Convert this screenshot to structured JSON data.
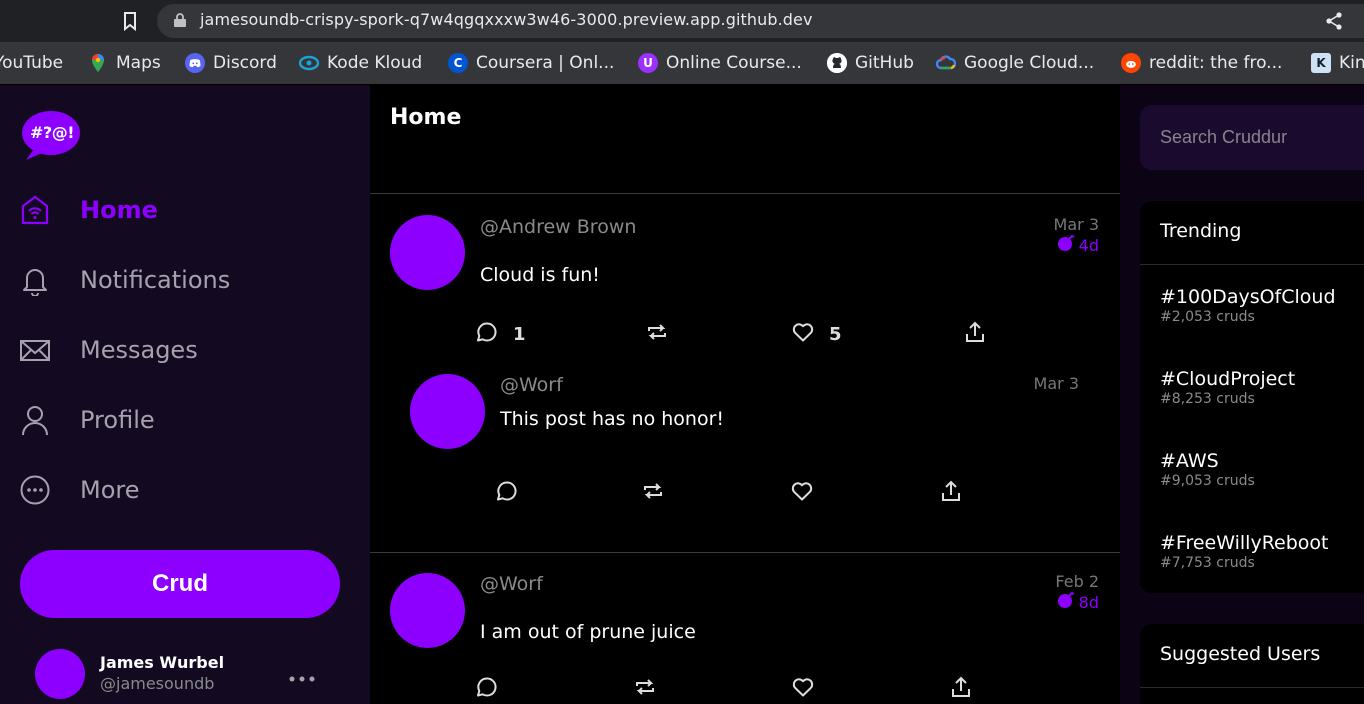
{
  "browser": {
    "url": "jamesoundb-crispy-spork-q7w4qgqxxxw3w46-3000.preview.app.github.dev",
    "bookmarks": [
      {
        "label": "YouTube",
        "icon": "youtube-icon"
      },
      {
        "label": "Maps",
        "icon": "maps-icon"
      },
      {
        "label": "Discord",
        "icon": "discord-icon"
      },
      {
        "label": "Kode Kloud",
        "icon": "kodekloud-icon"
      },
      {
        "label": "Coursera | Onl...",
        "icon": "coursera-icon"
      },
      {
        "label": "Online Course...",
        "icon": "online-course-icon"
      },
      {
        "label": "GitHub",
        "icon": "github-icon"
      },
      {
        "label": "Google Cloud...",
        "icon": "google-cloud-icon"
      },
      {
        "label": "reddit: the fro...",
        "icon": "reddit-icon"
      },
      {
        "label": "Kin",
        "icon": "kin-icon"
      }
    ]
  },
  "colors": {
    "accent": "#8d00ff",
    "sidebar_bg": "#130a22",
    "muted": "#a5a1ad"
  },
  "logo": {
    "text": "#?@!"
  },
  "nav": [
    {
      "label": "Home",
      "icon": "home-icon",
      "active": true
    },
    {
      "label": "Notifications",
      "icon": "bell-icon",
      "active": false
    },
    {
      "label": "Messages",
      "icon": "mail-icon",
      "active": false
    },
    {
      "label": "Profile",
      "icon": "person-icon",
      "active": false
    },
    {
      "label": "More",
      "icon": "more-circle-icon",
      "active": false
    }
  ],
  "crud_button": "Crud",
  "current_user": {
    "name": "James Wurbel",
    "handle": "@jamesoundb",
    "more": "..."
  },
  "feed": {
    "title": "Home",
    "activities": [
      {
        "handle": "@Andrew Brown",
        "message": "Cloud is fun!",
        "date": "Mar 3",
        "expires": "4d",
        "replies": "1",
        "reposts": "",
        "likes": "5",
        "reply": {
          "handle": "@Worf",
          "message": "This post has no honor!",
          "date": "Mar 3"
        }
      },
      {
        "handle": "@Worf",
        "message": "I am out of prune juice",
        "date": "Feb 2",
        "expires": "8d"
      }
    ]
  },
  "search": {
    "placeholder": "Search Cruddur"
  },
  "trending": {
    "title": "Trending",
    "items": [
      {
        "tag": "#100DaysOfCloud",
        "count": "#2,053 cruds"
      },
      {
        "tag": "#CloudProject",
        "count": "#8,253 cruds"
      },
      {
        "tag": "#AWS",
        "count": "#9,053 cruds"
      },
      {
        "tag": "#FreeWillyReboot",
        "count": "#7,753 cruds"
      }
    ]
  },
  "suggested": {
    "title": "Suggested Users"
  }
}
